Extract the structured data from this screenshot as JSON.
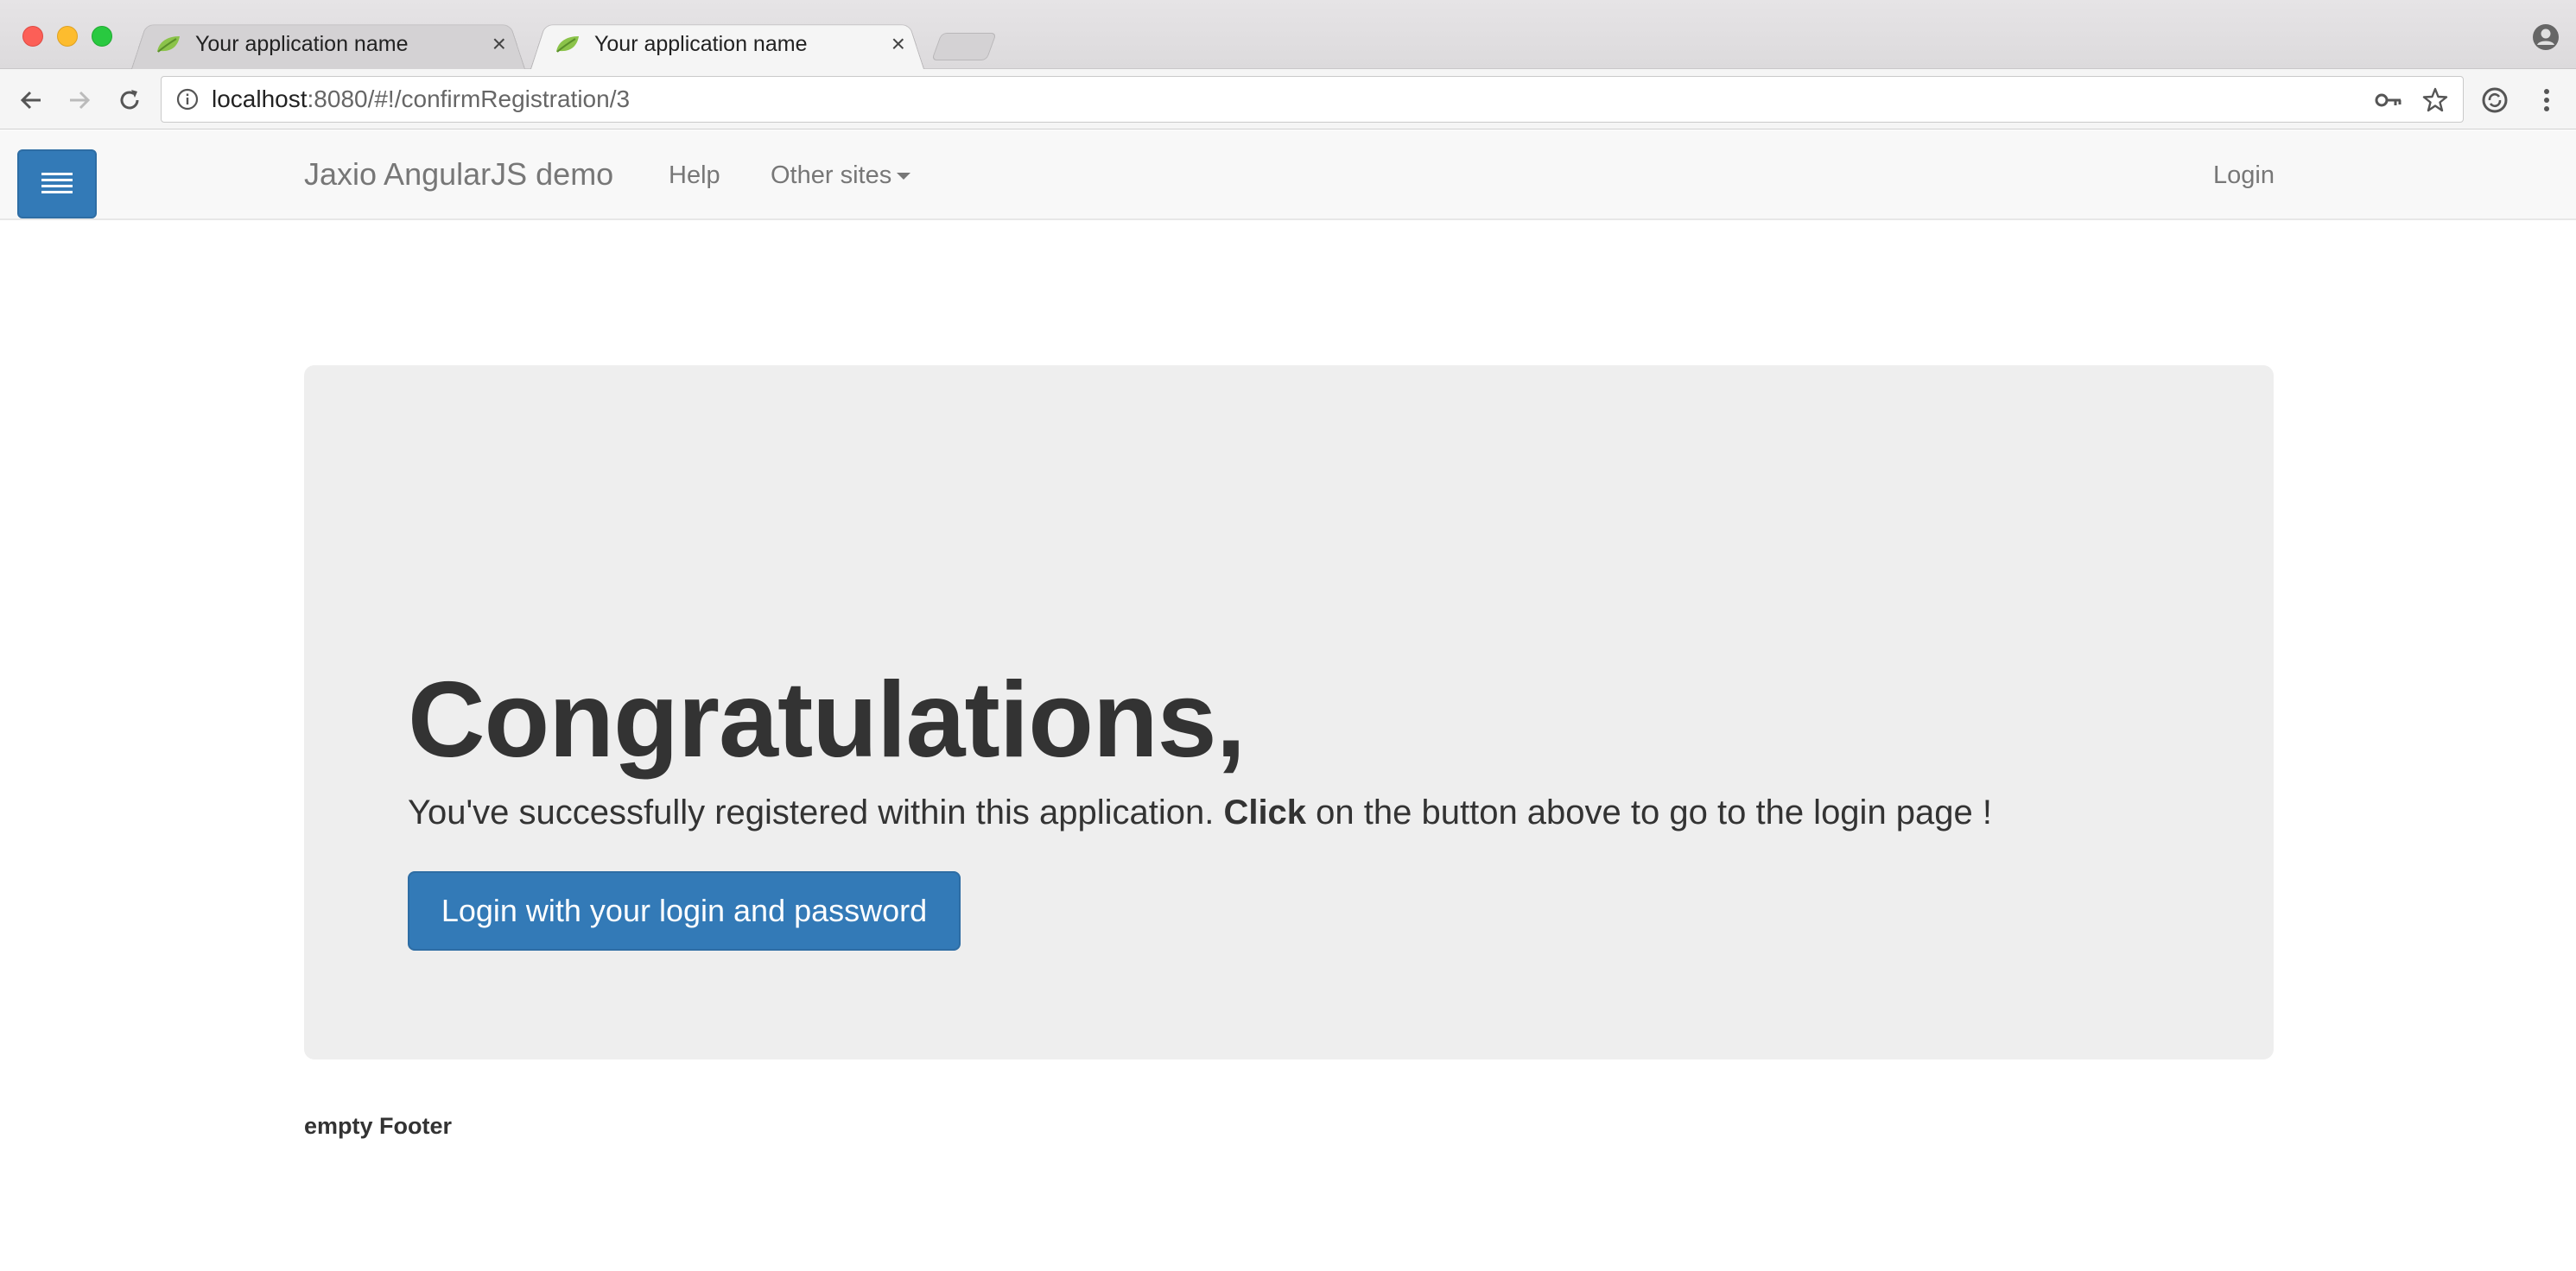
{
  "browser": {
    "tabs": [
      {
        "title": "Your application name",
        "active": false
      },
      {
        "title": "Your application name",
        "active": true
      }
    ],
    "close_glyph": "×",
    "url_host": "localhost",
    "url_rest": ":8080/#!/confirmRegistration/3"
  },
  "navbar": {
    "brand": "Jaxio AngularJS demo",
    "help": "Help",
    "other_sites": "Other sites",
    "login": "Login"
  },
  "jumbotron": {
    "title": "Congratulations,",
    "text_before": "You've successfully registered within this application. ",
    "text_bold": "Click",
    "text_after": " on the button above to go to the login page !",
    "button": "Login with your login and password"
  },
  "footer": {
    "text": "empty Footer"
  },
  "colors": {
    "primary": "#337ab7",
    "jumbotron_bg": "#eeeeee",
    "navbar_bg": "#f8f8f8"
  }
}
